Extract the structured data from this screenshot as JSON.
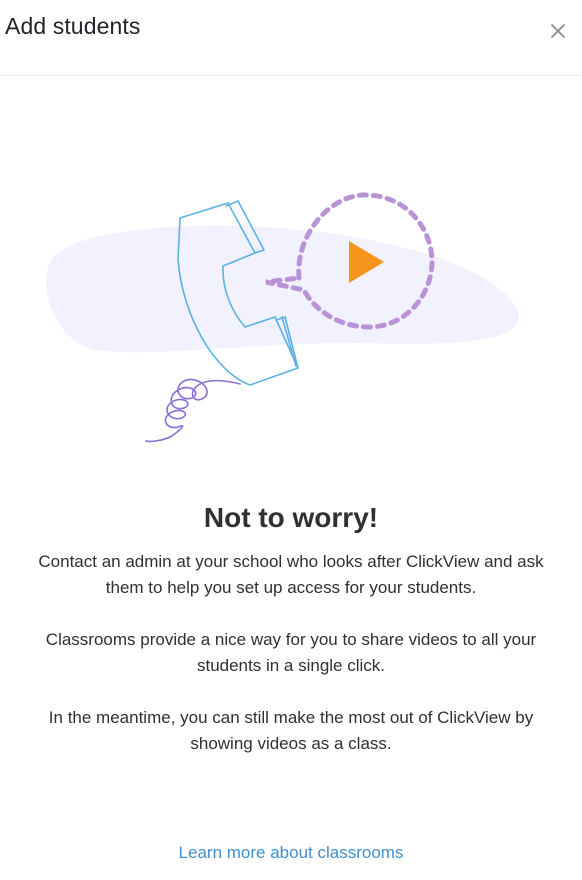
{
  "header": {
    "title": "Add students",
    "close_icon": "close-icon"
  },
  "illustration": {
    "icons": [
      "phone-handset-icon",
      "speech-bubble-icon",
      "play-icon",
      "cord-icon"
    ],
    "colors": {
      "blob": "#f2f1fe",
      "phone": "#5ab1e4",
      "bubble": "#b993d6",
      "play": "#f7941d",
      "cord": "#8a6fd6"
    }
  },
  "content": {
    "heading": "Not to worry!",
    "paragraph1": "Contact an admin at your school who looks after ClickView and ask them to help you set up access for your students.",
    "paragraph2": "Classrooms provide a nice way for you to share videos to all your students in a single click.",
    "paragraph3": "In the meantime, you can still make the most out of ClickView by showing videos as a class.",
    "link": "Learn more about classrooms"
  }
}
